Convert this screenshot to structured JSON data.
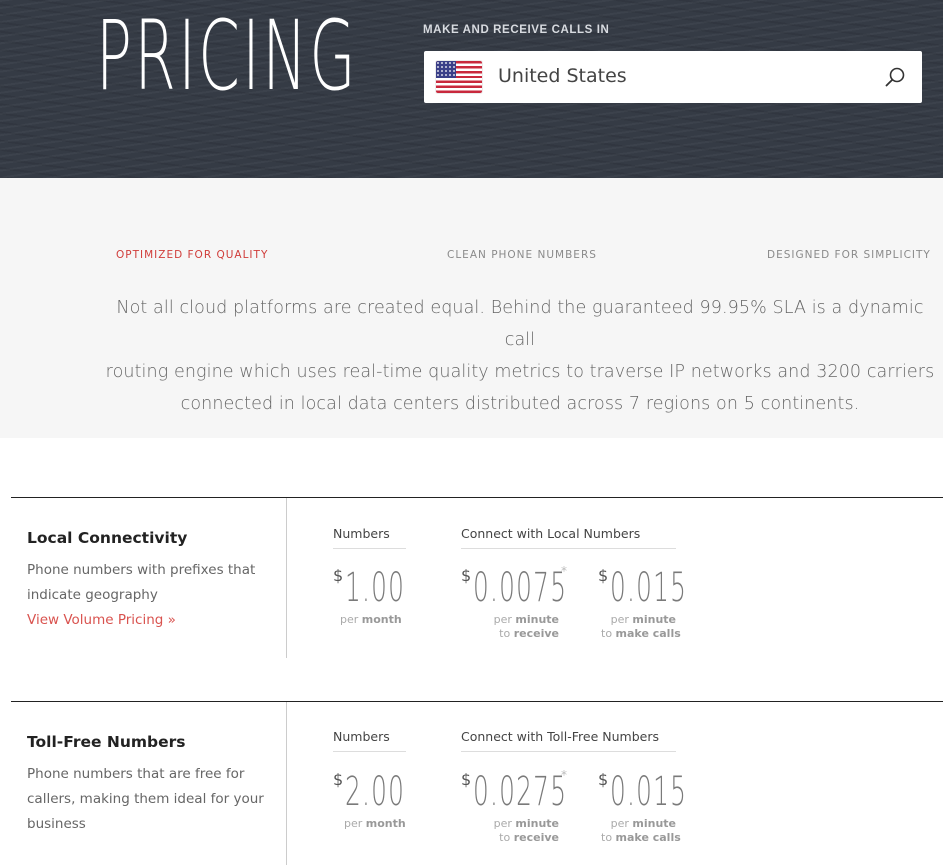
{
  "header": {
    "title": "PRICING",
    "label": "MAKE AND RECEIVE CALLS IN",
    "country": {
      "name": "United States",
      "flag_icon": "us-flag-icon",
      "search_icon": "search-icon"
    }
  },
  "features": {
    "tabs": [
      {
        "label": "OPTIMIZED FOR QUALITY",
        "active": true
      },
      {
        "label": "CLEAN PHONE NUMBERS",
        "active": false
      },
      {
        "label": "DESIGNED FOR SIMPLICITY",
        "active": false
      }
    ],
    "description_lines": [
      "Not all cloud platforms are created equal. Behind the guaranteed 99.95% SLA is a dynamic call",
      "routing engine which uses real-time quality metrics to traverse IP networks and 3200 carriers",
      "connected in local data centers distributed across 7 regions on 5 continents."
    ]
  },
  "pricing": [
    {
      "title": "Local Connectivity",
      "description": "Phone numbers with prefixes that indicate geography",
      "link": "View Volume Pricing »",
      "numbers_header": "Numbers",
      "connect_header": "Connect with Local Numbers",
      "number_price": {
        "currency": "$",
        "amount": "1.00",
        "unit_plain": "per",
        "unit_bold": "month"
      },
      "receive_price": {
        "currency": "$",
        "amount": "0.0075",
        "star": "*",
        "unit_plain_1": "per",
        "unit_bold_1": "minute",
        "unit_plain_2": "to",
        "unit_bold_2": "receive"
      },
      "make_price": {
        "currency": "$",
        "amount": "0.015",
        "unit_plain_1": "per",
        "unit_bold_1": "minute",
        "unit_plain_2": "to",
        "unit_bold_2": "make calls"
      }
    },
    {
      "title": "Toll-Free Numbers",
      "description": "Phone numbers that are free for callers, making them ideal for your business",
      "link": "",
      "numbers_header": "Numbers",
      "connect_header": "Connect with Toll-Free Numbers",
      "number_price": {
        "currency": "$",
        "amount": "2.00",
        "unit_plain": "per",
        "unit_bold": "month"
      },
      "receive_price": {
        "currency": "$",
        "amount": "0.0275",
        "star": "*",
        "unit_plain_1": "per",
        "unit_bold_1": "minute",
        "unit_plain_2": "to",
        "unit_bold_2": "receive"
      },
      "make_price": {
        "currency": "$",
        "amount": "0.015",
        "unit_plain_1": "per",
        "unit_bold_1": "minute",
        "unit_plain_2": "to",
        "unit_bold_2": "make calls"
      }
    }
  ],
  "colors": {
    "header_bg": "#353b45",
    "accent_red": "#d03d3a",
    "band_bg": "#f6f6f6"
  }
}
